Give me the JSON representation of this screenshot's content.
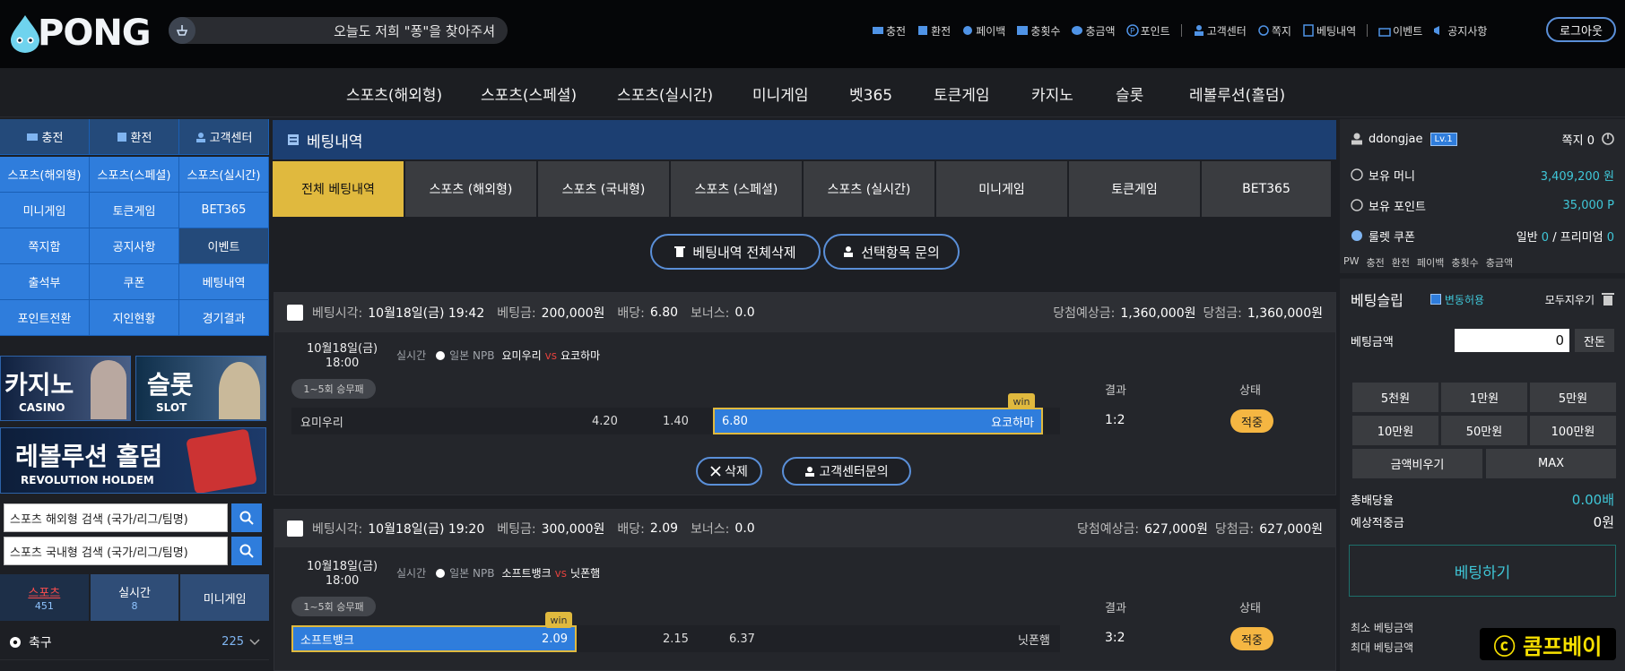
{
  "brand": {
    "logo_text": "PONG"
  },
  "marquee": {
    "text": "오늘도 저희 \"퐁\"을 찾아주셔"
  },
  "topnav": [
    {
      "label": "충전",
      "icon": "wallet-icon"
    },
    {
      "label": "환전",
      "icon": "exchange-icon"
    },
    {
      "label": "페이백",
      "icon": "payback-icon"
    },
    {
      "label": "충횟수",
      "icon": "count-icon"
    },
    {
      "label": "충금액",
      "icon": "coins-icon"
    },
    {
      "label": "포인트",
      "icon": "point-icon"
    },
    {
      "label": "고객센터",
      "icon": "support-icon"
    },
    {
      "label": "쪽지",
      "icon": "message-icon"
    },
    {
      "label": "베팅내역",
      "icon": "list-icon"
    },
    {
      "label": "이벤트",
      "icon": "gift-icon"
    },
    {
      "label": "공지사항",
      "icon": "megaphone-icon"
    }
  ],
  "logout_label": "로그아웃",
  "mainnav": [
    "스포츠(해외형)",
    "스포츠(스페셜)",
    "스포츠(실시간)",
    "미니게임",
    "벳365",
    "토큰게임",
    "카지노",
    "슬롯",
    "레볼루션(홀덤)"
  ],
  "left": {
    "quick": [
      "충전",
      "환전",
      "고객센터"
    ],
    "grid": [
      [
        "스포츠(해외형)",
        "스포츠(스페셜)",
        "스포츠(실시간)"
      ],
      [
        "미니게임",
        "토큰게임",
        "BET365"
      ],
      [
        "쪽지함",
        "공지사항",
        "이벤트"
      ],
      [
        "출석부",
        "쿠폰",
        "베팅내역"
      ],
      [
        "포인트전환",
        "지인현황",
        "경기결과"
      ]
    ],
    "banners": {
      "casino_kr": "카지노",
      "casino_en": "CASINO",
      "slot_kr": "슬롯",
      "slot_en": "SLOT",
      "holdem_kr": "레볼루션 홀덤",
      "holdem_en": "REVOLUTION HOLDEM"
    },
    "search_overseas": "스포츠 해외형 검색 (국가/리그/팀명)",
    "search_domestic": "스포츠 국내형 검색 (국가/리그/팀명)",
    "tabs": [
      {
        "label": "스포츠",
        "count": "451"
      },
      {
        "label": "실시간",
        "count": "8"
      },
      {
        "label": "미니게임",
        "count": ""
      }
    ],
    "sport": {
      "name": "축구",
      "count": "225"
    }
  },
  "main": {
    "title": "베팅내역",
    "tabs": [
      "전체 베팅내역",
      "스포츠 (해외형)",
      "스포츠 (국내형)",
      "스포츠 (스페셜)",
      "스포츠 (실시간)",
      "미니게임",
      "토큰게임",
      "BET365"
    ],
    "delete_all": "베팅내역 전체삭제",
    "inquire_selected": "선택항목 문의",
    "labels": {
      "bet_time": "베팅시각:",
      "bet_amount": "베팅금:",
      "odds": "배당:",
      "bonus": "보너스:",
      "expected_win": "당첨예상금:",
      "win_amount": "당첨금:",
      "result": "결과",
      "status": "상태",
      "realtime": "실시간",
      "vs": "vs",
      "round": "1~5회 승무패",
      "win": "win"
    },
    "delete_label": "삭제",
    "support_inquiry": "고객센터문의",
    "bets": [
      {
        "time": "10월18일(금) 19:42",
        "amount": "200,000원",
        "odds": "6.80",
        "bonus": "0.0",
        "expected": "1,360,000원",
        "won": "1,360,000원",
        "date_line1": "10월18일(금)",
        "date_line2": "18:00",
        "league": "일본 NPB",
        "home": "요미우리",
        "away": "요코하마",
        "row_home": "요미우리",
        "odds_home": "4.20",
        "odds_draw": "1.40",
        "odds_away": "6.80",
        "row_away": "요코하마",
        "score": "1:2",
        "status": "적중"
      },
      {
        "time": "10월18일(금) 19:20",
        "amount": "300,000원",
        "odds": "2.09",
        "bonus": "0.0",
        "expected": "627,000원",
        "won": "627,000원",
        "date_line1": "10월18일(금)",
        "date_line2": "18:00",
        "league": "일본 NPB",
        "home": "소프트뱅크",
        "away": "닛폰햄",
        "row_home": "소프트뱅크",
        "odds_home": "2.09",
        "odds_draw": "2.15",
        "odds_away": "6.37",
        "row_away": "닛폰햄",
        "score": "3:2",
        "status": "적중"
      }
    ]
  },
  "right": {
    "username": "ddongjae",
    "level": "Lv.1",
    "messages": "쪽지 0",
    "money_label": "보유 머니",
    "money": "3,409,200 원",
    "point_label": "보유 포인트",
    "point": "35,000 P",
    "coupon_label": "룰렛 쿠폰",
    "coupon_normal_label": "일반",
    "coupon_normal": "0",
    "coupon_premium_label": "프리미엄",
    "coupon_premium": "0",
    "quick": [
      "PW",
      "충전",
      "환전",
      "페이백",
      "충횟수",
      "충금액"
    ],
    "slip_title": "베팅슬립",
    "variable_allow": "변동허용",
    "clear_all": "모두지우기",
    "bet_amount_label": "베팅금액",
    "bet_amount_value": "0",
    "remain": "잔돈",
    "amounts": [
      "5천원",
      "1만원",
      "5만원",
      "10만원",
      "50만원",
      "100만원"
    ],
    "clear_amount": "금액비우기",
    "max": "MAX",
    "total_odds_label": "총배당율",
    "total_odds": "0.00배",
    "expected_label": "예상적중금",
    "expected": "0원",
    "place_bet": "베팅하기",
    "min_bet_label": "최소 베팅금액",
    "max_bet_label": "최대 베팅금액"
  },
  "watermark": "ⓒ 콤프베이"
}
